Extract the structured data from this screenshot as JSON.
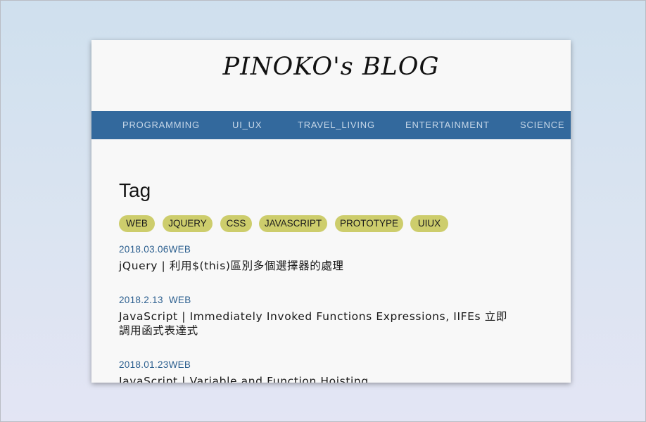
{
  "blog": {
    "title": "PINOKO's BLOG"
  },
  "nav": {
    "items": [
      {
        "label": "PROGRAMMING"
      },
      {
        "label": "UI_UX"
      },
      {
        "label": "TRAVEL_LIVING"
      },
      {
        "label": "ENTERTAINMENT"
      },
      {
        "label": "SCIENCE"
      }
    ]
  },
  "page": {
    "heading": "Tag"
  },
  "tags": [
    {
      "label": "WEB"
    },
    {
      "label": "JQUERY"
    },
    {
      "label": "CSS"
    },
    {
      "label": "JAVASCRIPT"
    },
    {
      "label": "PROTOTYPE"
    },
    {
      "label": "UIUX"
    }
  ],
  "posts": [
    {
      "meta": "2018.03.06WEB",
      "title": "jQuery | 利用$(this)區別多個選擇器的處理"
    },
    {
      "meta": "2018.2.13  WEB",
      "title": "JavaScript | Immediately Invoked Functions Expressions, IIFEs 立即調用函式表達式"
    },
    {
      "meta": "2018.01.23WEB",
      "title": "JavaScript | Variable and Function Hoisting"
    }
  ],
  "colors": {
    "nav_background": "#33699d",
    "nav_text": "#c6d7e8",
    "tag_background": "#cdcd6c",
    "meta_text": "#2c5f8f"
  }
}
